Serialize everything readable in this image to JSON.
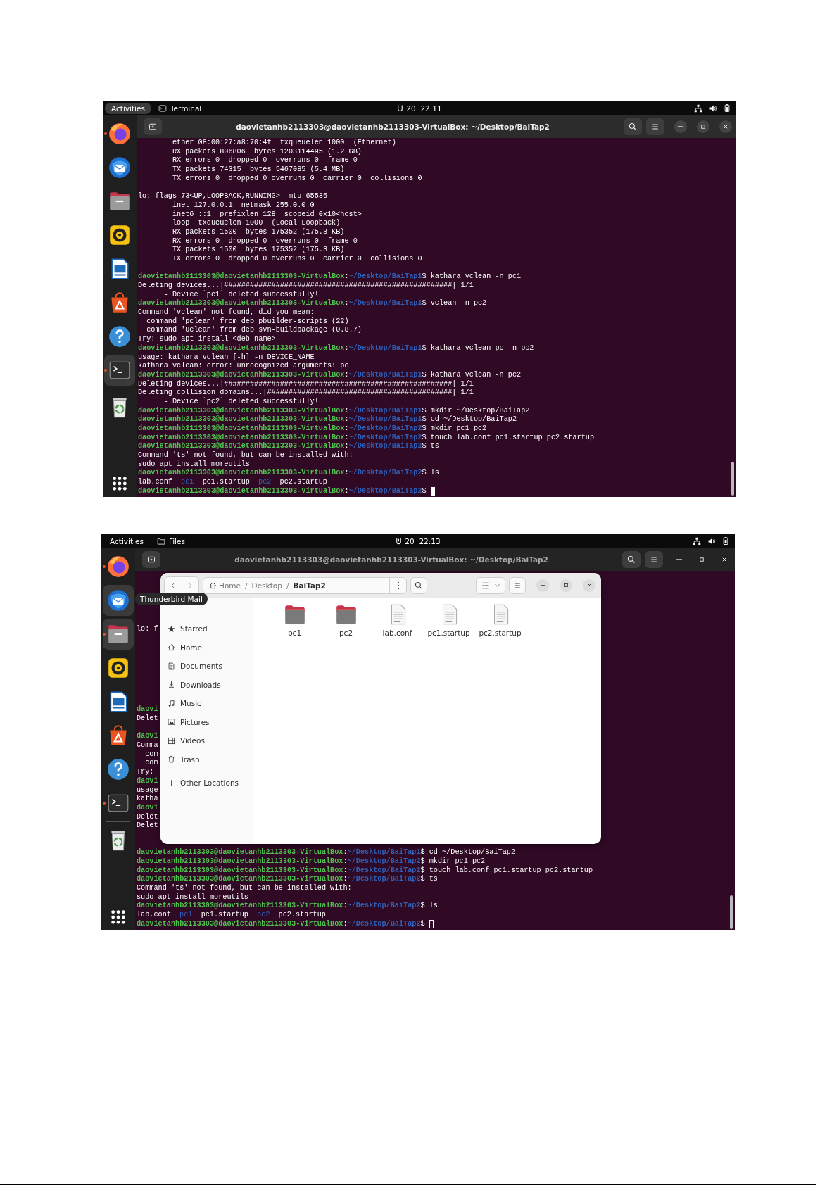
{
  "screenshots": [
    {
      "top_bar": {
        "activities": {
          "label": "Activities",
          "selected": true
        },
        "app": {
          "kind": "terminal",
          "label": "Terminal"
        },
        "clock": "20  22:11"
      },
      "dock": [
        {
          "kind": "firefox",
          "running": true,
          "highlighted": false
        },
        {
          "kind": "thunderbird",
          "running": false,
          "highlighted": false
        },
        {
          "kind": "files",
          "running": false,
          "highlighted": false
        },
        {
          "kind": "rhythmbox",
          "running": false,
          "highlighted": false
        },
        {
          "kind": "writer",
          "running": false,
          "highlighted": false
        },
        {
          "kind": "appcenter",
          "running": false,
          "highlighted": false
        },
        {
          "kind": "help",
          "running": false,
          "highlighted": false
        },
        {
          "kind": "terminal",
          "running": true,
          "highlighted": true
        },
        {
          "kind": "trash",
          "running": false,
          "highlighted": false
        }
      ],
      "terminal": {
        "title": "daovietanhb2113303@daovietanhb2113303-VirtualBox: ~/Desktop/BaiTap2",
        "active": true,
        "lines": [
          {
            "kind": "output",
            "text": "        ether 08:00:27:a8:70:4f  txqueuelen 1000  (Ethernet)"
          },
          {
            "kind": "output",
            "text": "        RX packets 806806  bytes 1203114495 (1.2 GB)"
          },
          {
            "kind": "output",
            "text": "        RX errors 0  dropped 0  overruns 0  frame 0"
          },
          {
            "kind": "output",
            "text": "        TX packets 74315  bytes 5467085 (5.4 MB)"
          },
          {
            "kind": "output",
            "text": "        TX errors 0  dropped 0 overruns 0  carrier 0  collisions 0"
          },
          {
            "kind": "blank"
          },
          {
            "kind": "output",
            "text": "lo: flags=73<UP,LOOPBACK,RUNNING>  mtu 65536"
          },
          {
            "kind": "output",
            "text": "        inet 127.0.0.1  netmask 255.0.0.0"
          },
          {
            "kind": "output",
            "text": "        inet6 ::1  prefixlen 128  scopeid 0x10<host>"
          },
          {
            "kind": "output",
            "text": "        loop  txqueuelen 1000  (Local Loopback)"
          },
          {
            "kind": "output",
            "text": "        RX packets 1500  bytes 175352 (175.3 KB)"
          },
          {
            "kind": "output",
            "text": "        RX errors 0  dropped 0  overruns 0  frame 0"
          },
          {
            "kind": "output",
            "text": "        TX packets 1500  bytes 175352 (175.3 KB)"
          },
          {
            "kind": "output",
            "text": "        TX errors 0  dropped 0 overruns 0  carrier 0  collisions 0"
          },
          {
            "kind": "blank"
          },
          {
            "kind": "prompt",
            "host": "daovietanhb2113303@daovietanhb2113303-VirtualBox",
            "sep": ":",
            "path": "~/Desktop/BaiTap1",
            "command": "$ kathara vclean -n pc1"
          },
          {
            "kind": "output",
            "text": "Deleting devices...|#####################################################| 1/1"
          },
          {
            "kind": "output",
            "text": "      - Device `pc1` deleted successfully!"
          },
          {
            "kind": "prompt",
            "host": "daovietanhb2113303@daovietanhb2113303-VirtualBox",
            "sep": ":",
            "path": "~/Desktop/BaiTap1",
            "command": "$ vclean -n pc2"
          },
          {
            "kind": "output",
            "text": "Command 'vclean' not found, did you mean:"
          },
          {
            "kind": "output",
            "text": "  command 'pclean' from deb pbuilder-scripts (22)"
          },
          {
            "kind": "output",
            "text": "  command 'uclean' from deb svn-buildpackage (0.8.7)"
          },
          {
            "kind": "output",
            "text": "Try: sudo apt install <deb name>"
          },
          {
            "kind": "prompt",
            "host": "daovietanhb2113303@daovietanhb2113303-VirtualBox",
            "sep": ":",
            "path": "~/Desktop/BaiTap1",
            "command": "$ kathara vclean pc -n pc2"
          },
          {
            "kind": "output",
            "text": "usage: kathara vclean [-h] -n DEVICE_NAME"
          },
          {
            "kind": "output",
            "text": "kathara vclean: error: unrecognized arguments: pc"
          },
          {
            "kind": "prompt",
            "host": "daovietanhb2113303@daovietanhb2113303-VirtualBox",
            "sep": ":",
            "path": "~/Desktop/BaiTap1",
            "command": "$ kathara vclean -n pc2"
          },
          {
            "kind": "output",
            "text": "Deleting devices...|#####################################################| 1/1"
          },
          {
            "kind": "output",
            "text": "Deleting collision domains...|###########################################| 1/1"
          },
          {
            "kind": "output",
            "text": "      - Device `pc2` deleted successfully!"
          },
          {
            "kind": "prompt",
            "host": "daovietanhb2113303@daovietanhb2113303-VirtualBox",
            "sep": ":",
            "path": "~/Desktop/BaiTap1",
            "command": "$ mkdir ~/Desktop/BaiTap2"
          },
          {
            "kind": "prompt",
            "host": "daovietanhb2113303@daovietanhb2113303-VirtualBox",
            "sep": ":",
            "path": "~/Desktop/BaiTap1",
            "command": "$ cd ~/Desktop/BaiTap2"
          },
          {
            "kind": "prompt",
            "host": "daovietanhb2113303@daovietanhb2113303-VirtualBox",
            "sep": ":",
            "path": "~/Desktop/BaiTap2",
            "command": "$ mkdir pc1 pc2"
          },
          {
            "kind": "prompt",
            "host": "daovietanhb2113303@daovietanhb2113303-VirtualBox",
            "sep": ":",
            "path": "~/Desktop/BaiTap2",
            "command": "$ touch lab.conf pc1.startup pc2.startup"
          },
          {
            "kind": "prompt",
            "host": "daovietanhb2113303@daovietanhb2113303-VirtualBox",
            "sep": ":",
            "path": "~/Desktop/BaiTap2",
            "command": "$ ts"
          },
          {
            "kind": "output",
            "text": "Command 'ts' not found, but can be installed with:"
          },
          {
            "kind": "output",
            "text": "sudo apt install moreutils"
          },
          {
            "kind": "prompt",
            "host": "daovietanhb2113303@daovietanhb2113303-VirtualBox",
            "sep": ":",
            "path": "~/Desktop/BaiTap2",
            "command": "$ ls"
          },
          {
            "kind": "listing",
            "entries": [
              {
                "name": "lab.conf",
                "dir": false
              },
              {
                "name": "pc1",
                "dir": true
              },
              {
                "name": "pc1.startup",
                "dir": false
              },
              {
                "name": "pc2",
                "dir": true
              },
              {
                "name": "pc2.startup",
                "dir": false
              }
            ]
          },
          {
            "kind": "prompt",
            "host": "daovietanhb2113303@daovietanhb2113303-VirtualBox",
            "sep": ":",
            "path": "~/Desktop/BaiTap2",
            "command": "$",
            "cursor_filled": true
          }
        ]
      }
    },
    {
      "top_bar": {
        "activities": {
          "label": "Activities",
          "selected": false
        },
        "app": {
          "kind": "files",
          "label": "Files"
        },
        "clock": "20  22:13"
      },
      "dock": [
        {
          "kind": "firefox",
          "running": true,
          "highlighted": false
        },
        {
          "kind": "thunderbird",
          "running": false,
          "highlighted": true
        },
        {
          "kind": "files",
          "running": true,
          "highlighted": true
        },
        {
          "kind": "rhythmbox",
          "running": false,
          "highlighted": false
        },
        {
          "kind": "writer",
          "running": false,
          "highlighted": false
        },
        {
          "kind": "appcenter",
          "running": false,
          "highlighted": false
        },
        {
          "kind": "help",
          "running": false,
          "highlighted": false
        },
        {
          "kind": "terminal",
          "running": true,
          "highlighted": false
        },
        {
          "kind": "trash",
          "running": false,
          "highlighted": false
        }
      ],
      "terminal": {
        "title": "daovietanhb2113303@daovietanhb2113303-VirtualBox: ~/Desktop/BaiTap2",
        "active": false,
        "lines": [
          {
            "kind": "blank"
          },
          {
            "kind": "blank"
          },
          {
            "kind": "blank"
          },
          {
            "kind": "blank"
          },
          {
            "kind": "blank"
          },
          {
            "kind": "blank"
          },
          {
            "kind": "output",
            "text": "lo: f"
          },
          {
            "kind": "blank"
          },
          {
            "kind": "blank"
          },
          {
            "kind": "blank"
          },
          {
            "kind": "blank"
          },
          {
            "kind": "blank"
          },
          {
            "kind": "blank"
          },
          {
            "kind": "blank"
          },
          {
            "kind": "blank"
          },
          {
            "kind": "prompt",
            "host": "daovi"
          },
          {
            "kind": "output",
            "text": "Delet"
          },
          {
            "kind": "blank"
          },
          {
            "kind": "prompt",
            "host": "daovi"
          },
          {
            "kind": "output",
            "text": "Comma"
          },
          {
            "kind": "output",
            "text": "  com"
          },
          {
            "kind": "output",
            "text": "  com"
          },
          {
            "kind": "output",
            "text": "Try: "
          },
          {
            "kind": "prompt",
            "host": "daovi"
          },
          {
            "kind": "output",
            "text": "usage"
          },
          {
            "kind": "output",
            "text": "katha"
          },
          {
            "kind": "prompt",
            "host": "daovi"
          },
          {
            "kind": "output",
            "text": "Delet"
          },
          {
            "kind": "output",
            "text": "Delet"
          },
          {
            "kind": "blank"
          },
          {
            "kind": "blank"
          },
          {
            "kind": "prompt",
            "host": "daovietanhb2113303@daovietanhb2113303-VirtualBox",
            "sep": ":",
            "path": "~/Desktop/BaiTap1",
            "command": "$ cd ~/Desktop/BaiTap2"
          },
          {
            "kind": "prompt",
            "host": "daovietanhb2113303@daovietanhb2113303-VirtualBox",
            "sep": ":",
            "path": "~/Desktop/BaiTap2",
            "command": "$ mkdir pc1 pc2"
          },
          {
            "kind": "prompt",
            "host": "daovietanhb2113303@daovietanhb2113303-VirtualBox",
            "sep": ":",
            "path": "~/Desktop/BaiTap2",
            "command": "$ touch lab.conf pc1.startup pc2.startup"
          },
          {
            "kind": "prompt",
            "host": "daovietanhb2113303@daovietanhb2113303-VirtualBox",
            "sep": ":",
            "path": "~/Desktop/BaiTap2",
            "command": "$ ts"
          },
          {
            "kind": "output",
            "text": "Command 'ts' not found, but can be installed with:"
          },
          {
            "kind": "output",
            "text": "sudo apt install moreutils"
          },
          {
            "kind": "prompt",
            "host": "daovietanhb2113303@daovietanhb2113303-VirtualBox",
            "sep": ":",
            "path": "~/Desktop/BaiTap2",
            "command": "$ ls"
          },
          {
            "kind": "listing",
            "entries": [
              {
                "name": "lab.conf",
                "dir": false
              },
              {
                "name": "pc1",
                "dir": true
              },
              {
                "name": "pc1.startup",
                "dir": false
              },
              {
                "name": "pc2",
                "dir": true
              },
              {
                "name": "pc2.startup",
                "dir": false
              }
            ]
          },
          {
            "kind": "prompt",
            "host": "daovietanhb2113303@daovietanhb2113303-VirtualBox",
            "sep": ":",
            "path": "~/Desktop/BaiTap2",
            "command": "$",
            "cursor_filled": false
          }
        ]
      },
      "files_window": {
        "path": [
          {
            "label": "Home",
            "selected": false
          },
          {
            "separator": "/",
            "label": "Desktop",
            "selected": false
          },
          {
            "separator": "/",
            "label": "BaiTap2",
            "selected": true
          }
        ],
        "sidebar": [
          {
            "kind": "starred",
            "label": "Starred",
            "selected": false
          },
          {
            "kind": "home",
            "label": "Home",
            "selected": false
          },
          {
            "kind": "documents",
            "label": "Documents",
            "selected": false
          },
          {
            "kind": "downloads",
            "label": "Downloads",
            "selected": false
          },
          {
            "kind": "music",
            "label": "Music",
            "selected": false
          },
          {
            "kind": "pictures",
            "label": "Pictures",
            "selected": false
          },
          {
            "kind": "videos",
            "label": "Videos",
            "selected": false
          },
          {
            "kind": "trash",
            "label": "Trash",
            "selected": false
          },
          {
            "kind": "other",
            "label": "Other Locations",
            "selected": false
          }
        ],
        "items": [
          {
            "kind": "folder",
            "name": "pc1"
          },
          {
            "kind": "folder",
            "name": "pc2"
          },
          {
            "kind": "file",
            "name": "lab.conf"
          },
          {
            "kind": "file",
            "name": "pc1.startup"
          },
          {
            "kind": "file",
            "name": "pc2.startup"
          }
        ]
      },
      "tooltip": {
        "label": "Thunderbird Mail"
      }
    }
  ]
}
